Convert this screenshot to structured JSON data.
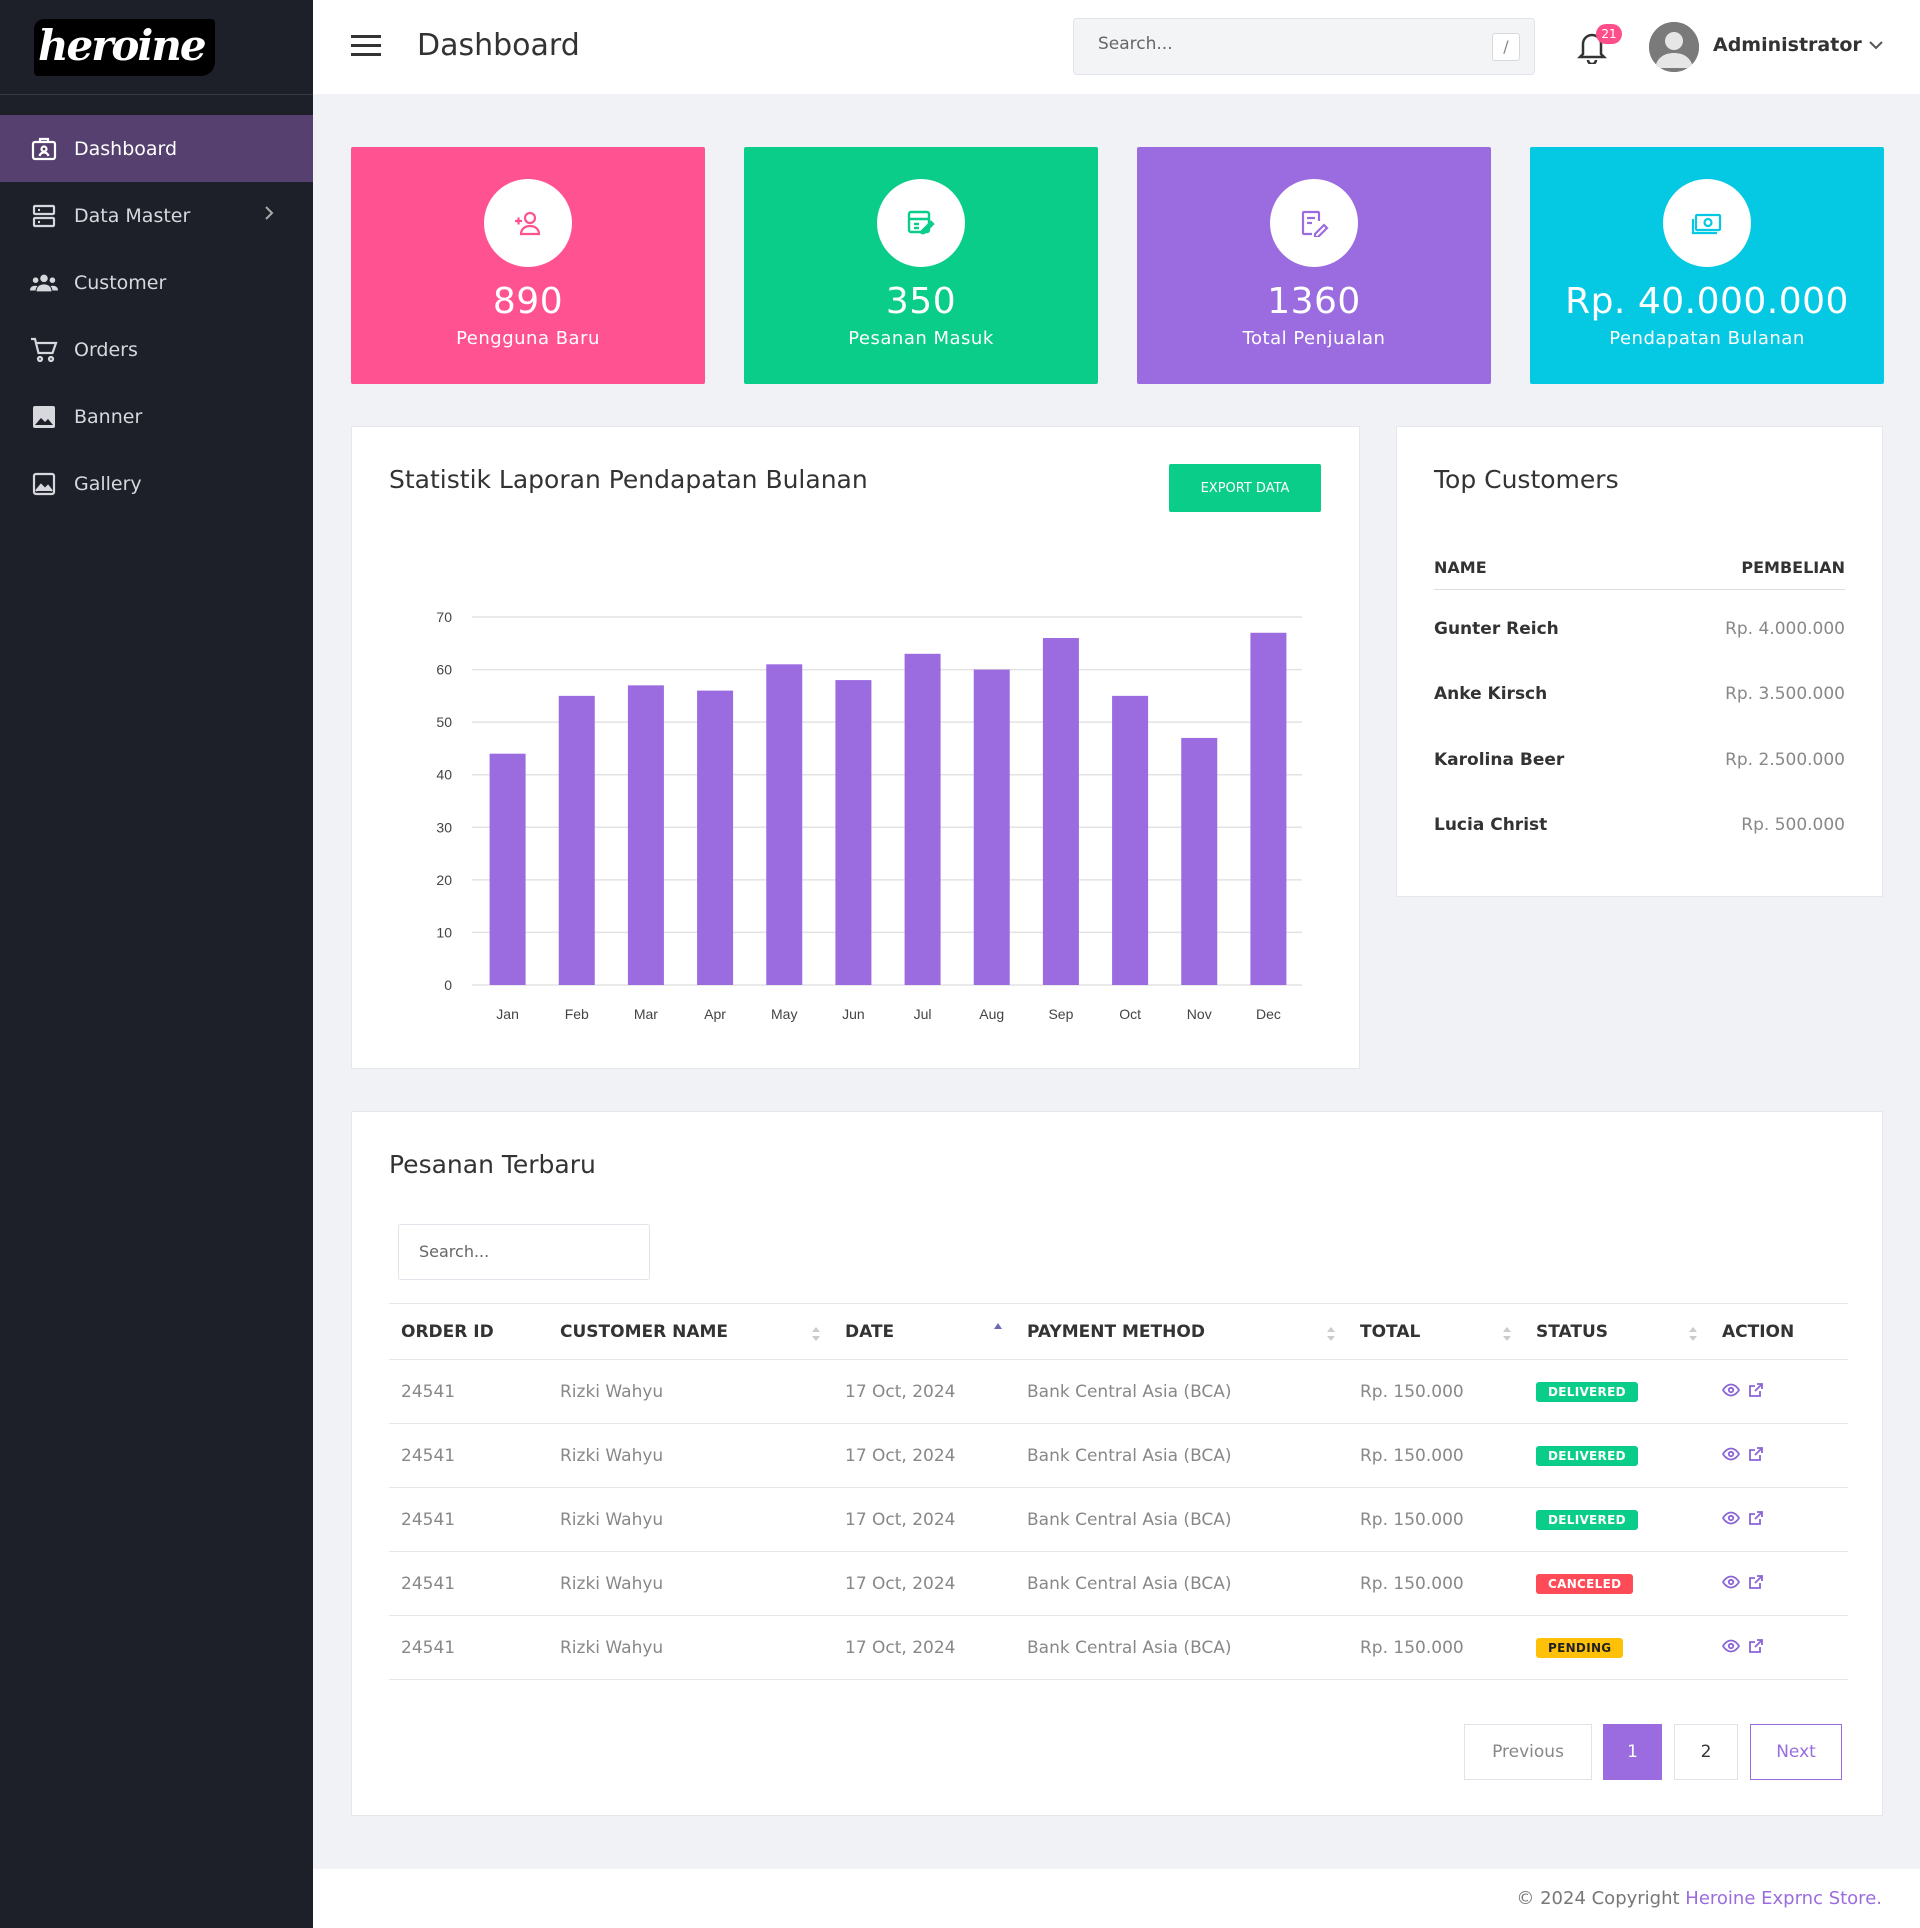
{
  "app": {
    "logo": "heroine",
    "accent": "#9b6cdf",
    "sidebar_bg": "#1e2029",
    "active_bg": "#55406f"
  },
  "sidebar": {
    "items": [
      {
        "label": "Dashboard",
        "icon": "dashboard-icon",
        "active": true
      },
      {
        "label": "Data Master",
        "icon": "server-icon",
        "has_submenu": true
      },
      {
        "label": "Customer",
        "icon": "users-icon"
      },
      {
        "label": "Orders",
        "icon": "cart-icon"
      },
      {
        "label": "Banner",
        "icon": "image-icon"
      },
      {
        "label": "Gallery",
        "icon": "gallery-icon"
      }
    ]
  },
  "header": {
    "title": "Dashboard",
    "search_placeholder": "Search...",
    "search_shortcut": "/",
    "notification_count": "21",
    "user_name": "Administrator"
  },
  "stats": [
    {
      "value": "890",
      "label": "Pengguna Baru",
      "color": "#ff5290",
      "icon": "user-add-icon"
    },
    {
      "value": "350",
      "label": "Pesanan Masuk",
      "color": "#0bcd8a",
      "icon": "order-edit-icon"
    },
    {
      "value": "1360",
      "label": "Total Penjualan",
      "color": "#9b6cdf",
      "icon": "sales-edit-icon"
    },
    {
      "value": "Rp. 40.000.000",
      "label": "Pendapatan Bulanan",
      "color": "#05c9e3",
      "icon": "money-icon"
    }
  ],
  "chart_panel": {
    "title": "Statistik Laporan Pendapatan Bulanan",
    "export_label": "EXPORT DATA"
  },
  "chart_data": {
    "type": "bar",
    "categories": [
      "Jan",
      "Feb",
      "Mar",
      "Apr",
      "May",
      "Jun",
      "Jul",
      "Aug",
      "Sep",
      "Oct",
      "Nov",
      "Dec"
    ],
    "values": [
      44,
      55,
      57,
      56,
      61,
      58,
      63,
      60,
      66,
      55,
      47,
      67
    ],
    "ylim": [
      0,
      70
    ],
    "yticks": [
      "0",
      "10",
      "20",
      "30",
      "40",
      "50",
      "60",
      "70"
    ],
    "bar_color": "#9b6cdf",
    "grid": true
  },
  "top_customers": {
    "title": "Top Customers",
    "col_name": "NAME",
    "col_purchase": "PEMBELIAN",
    "rows": [
      {
        "name": "Gunter Reich",
        "value": "Rp. 4.000.000"
      },
      {
        "name": "Anke Kirsch",
        "value": "Rp. 3.500.000"
      },
      {
        "name": "Karolina Beer",
        "value": "Rp. 2.500.000"
      },
      {
        "name": "Lucia Christ",
        "value": "Rp. 500.000"
      }
    ]
  },
  "orders": {
    "title": "Pesanan Terbaru",
    "search_placeholder": "Search...",
    "columns": [
      "ORDER ID",
      "CUSTOMER NAME",
      "DATE",
      "PAYMENT METHOD",
      "TOTAL",
      "STATUS",
      "ACTION"
    ],
    "rows": [
      {
        "id": "24541",
        "customer": "Rizki Wahyu",
        "date": "17 Oct, 2024",
        "payment": "Bank Central Asia (BCA)",
        "total": "Rp. 150.000",
        "status": "DELIVERED",
        "status_class": "delivered"
      },
      {
        "id": "24541",
        "customer": "Rizki Wahyu",
        "date": "17 Oct, 2024",
        "payment": "Bank Central Asia (BCA)",
        "total": "Rp. 150.000",
        "status": "DELIVERED",
        "status_class": "delivered"
      },
      {
        "id": "24541",
        "customer": "Rizki Wahyu",
        "date": "17 Oct, 2024",
        "payment": "Bank Central Asia (BCA)",
        "total": "Rp. 150.000",
        "status": "DELIVERED",
        "status_class": "delivered"
      },
      {
        "id": "24541",
        "customer": "Rizki Wahyu",
        "date": "17 Oct, 2024",
        "payment": "Bank Central Asia (BCA)",
        "total": "Rp. 150.000",
        "status": "CANCELED",
        "status_class": "canceled"
      },
      {
        "id": "24541",
        "customer": "Rizki Wahyu",
        "date": "17 Oct, 2024",
        "payment": "Bank Central Asia (BCA)",
        "total": "Rp. 150.000",
        "status": "PENDING",
        "status_class": "pending"
      }
    ],
    "pagination": {
      "previous": "Previous",
      "pages": [
        "1",
        "2"
      ],
      "current": "1",
      "next": "Next"
    }
  },
  "footer": {
    "prefix": "© 2024 Copyright ",
    "brand": "Heroine Exprnc Store."
  }
}
